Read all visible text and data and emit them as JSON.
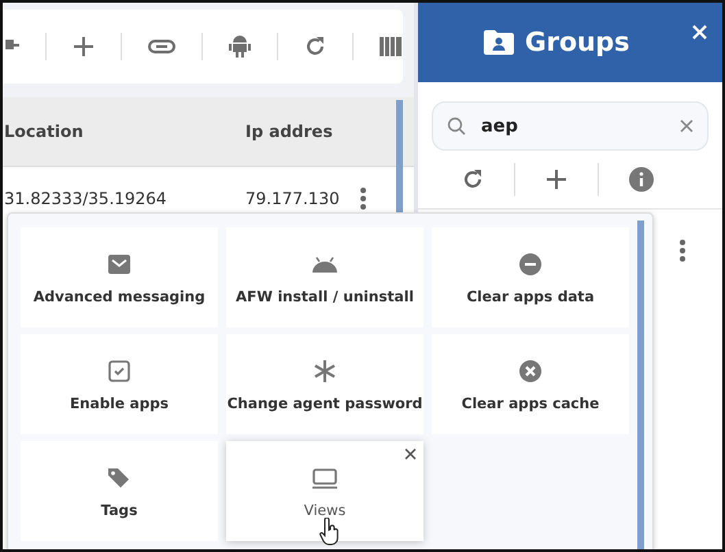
{
  "table": {
    "columns": [
      "Location",
      "Ip addres"
    ],
    "rows": [
      {
        "location": "31.82333/35.19264",
        "ip": "79.177.130"
      }
    ]
  },
  "groups_panel": {
    "title": "Groups",
    "search": {
      "value": "aep"
    }
  },
  "actions_menu": {
    "tiles": [
      {
        "label": "Advanced messaging",
        "hovered": false
      },
      {
        "label": "AFW install / uninstall",
        "hovered": false
      },
      {
        "label": "Clear apps data",
        "hovered": false
      },
      {
        "label": "Enable apps",
        "hovered": false
      },
      {
        "label": "Change agent password",
        "hovered": false
      },
      {
        "label": "Clear apps cache",
        "hovered": false
      },
      {
        "label": "Tags",
        "hovered": false
      },
      {
        "label": "Views",
        "hovered": true
      }
    ]
  }
}
